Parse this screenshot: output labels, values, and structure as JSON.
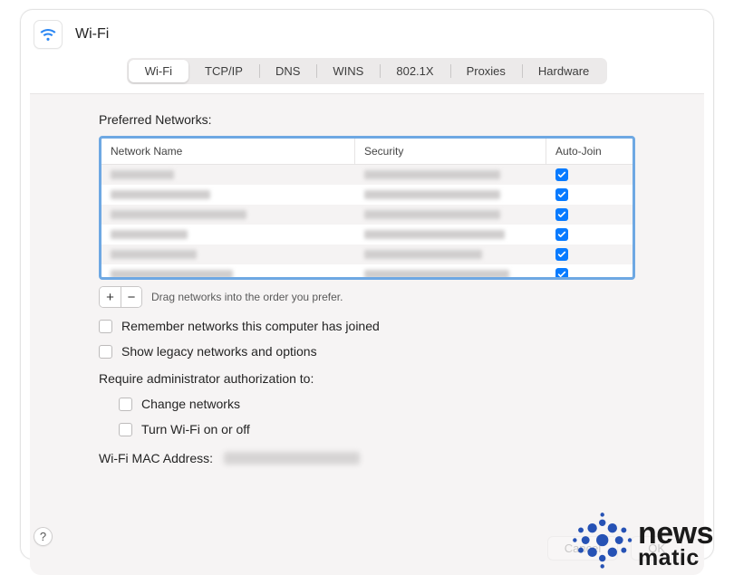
{
  "header": {
    "title": "Wi-Fi"
  },
  "tabs": [
    "Wi-Fi",
    "TCP/IP",
    "DNS",
    "WINS",
    "802.1X",
    "Proxies",
    "Hardware"
  ],
  "active_tab_index": 0,
  "section_label": "Preferred Networks:",
  "columns": {
    "name": "Network Name",
    "security": "Security",
    "autojoin": "Auto-Join"
  },
  "networks": [
    {
      "name_w": 70,
      "sec_w": 150,
      "aj": true
    },
    {
      "name_w": 110,
      "sec_w": 150,
      "aj": true
    },
    {
      "name_w": 150,
      "sec_w": 150,
      "aj": true
    },
    {
      "name_w": 85,
      "sec_w": 155,
      "aj": true
    },
    {
      "name_w": 95,
      "sec_w": 130,
      "aj": true
    },
    {
      "name_w": 135,
      "sec_w": 160,
      "aj": true
    }
  ],
  "drag_hint": "Drag networks into the order you prefer.",
  "options": {
    "remember": "Remember networks this computer has joined",
    "legacy": "Show legacy networks and options",
    "require_admin_label": "Require administrator authorization to:",
    "change_networks": "Change networks",
    "turn_wifi": "Turn Wi-Fi on or off"
  },
  "mac_label": "Wi-Fi MAC Address:",
  "buttons": {
    "cancel": "Cancel",
    "ok": "OK"
  },
  "help_glyph": "?",
  "watermark": {
    "line1": "news",
    "line2": "matic"
  }
}
